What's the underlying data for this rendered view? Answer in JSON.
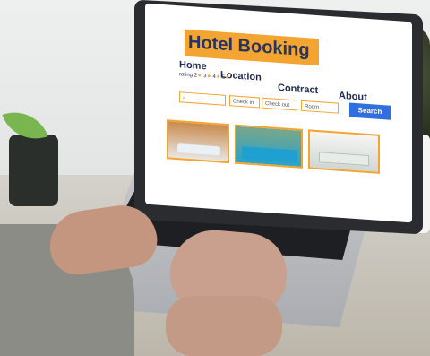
{
  "scene": {
    "description_colors": {
      "accent": "#f3a431",
      "title_text": "#27345f",
      "search_button": "#2f6fe0"
    }
  },
  "website": {
    "title": "Hotel Booking",
    "nav": [
      "Home",
      "Location",
      "Contract",
      "About"
    ],
    "rating_label": "rating",
    "rating_values": [
      "2",
      "3",
      "4",
      "5"
    ],
    "search_fields": {
      "checkin": "Check in",
      "checkout": "Check out",
      "room": "Room",
      "button": "Search"
    }
  }
}
